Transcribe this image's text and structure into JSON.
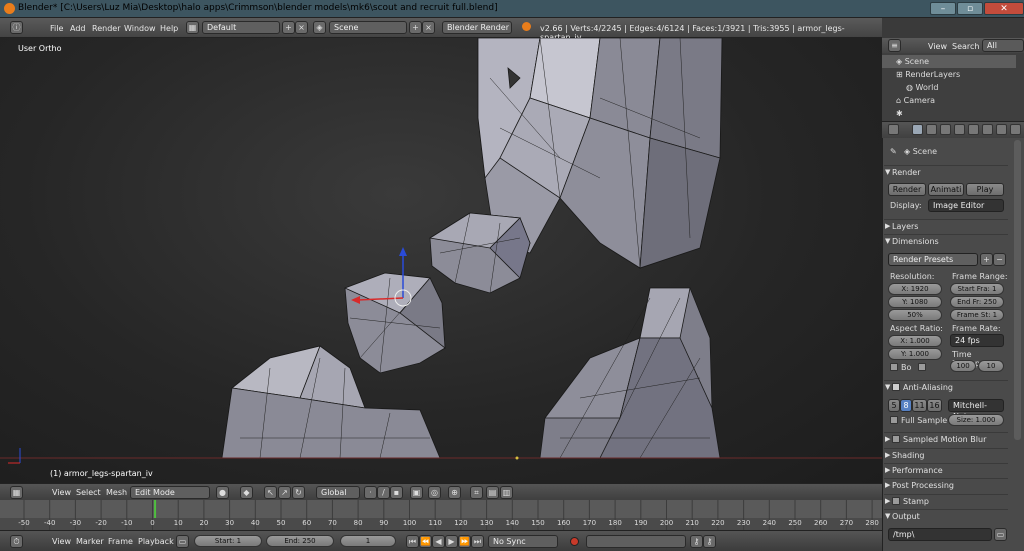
{
  "window": {
    "title": "Blender* [C:\\Users\\Luz Mia\\Desktop\\halo apps\\Crimmson\\blender models\\mk6\\scout and recruit full.blend]",
    "colors": {
      "accent": "#e97d1b",
      "titlebar": "#3d5560",
      "selected": "#5680c2"
    }
  },
  "menubar": {
    "items": [
      "File",
      "Add",
      "Render",
      "Window",
      "Help"
    ],
    "layout": "Default",
    "scene": "Scene",
    "engine": "Blender Render",
    "stats": "v2.66 | Verts:4/2245 | Edges:4/6124 | Faces:1/3921 | Tris:3955 | armor_legs-spartan_iv"
  },
  "viewport": {
    "view_label": "User Ortho",
    "object_label": "(1) armor_legs-spartan_iv"
  },
  "view_header": {
    "menus": [
      "View",
      "Select",
      "Mesh"
    ],
    "mode": "Edit Mode",
    "orientation": "Global"
  },
  "timeline": {
    "ticks": [
      "-50",
      "-40",
      "-30",
      "-20",
      "-10",
      "0",
      "10",
      "20",
      "30",
      "40",
      "50",
      "60",
      "70",
      "80",
      "90",
      "100",
      "110",
      "120",
      "130",
      "140",
      "150",
      "160",
      "170",
      "180",
      "190",
      "200",
      "210",
      "220",
      "230",
      "240",
      "250",
      "260",
      "270",
      "280"
    ],
    "current_frame": 1
  },
  "timeline_header": {
    "menus": [
      "View",
      "Marker",
      "Frame",
      "Playback"
    ],
    "start": "Start: 1",
    "end": "End: 250",
    "current": "1",
    "sync": "No Sync"
  },
  "outliner": {
    "header": [
      "View",
      "Search",
      "All Scenes"
    ],
    "rows": [
      "Scene",
      "RenderLayers",
      "World",
      "Camera"
    ]
  },
  "properties": {
    "context": "Scene",
    "render": {
      "title": "Render",
      "buttons": [
        "Render",
        "Animati",
        "Play"
      ],
      "display_label": "Display:",
      "display_value": "Image Editor"
    },
    "layers": "Layers",
    "dimensions": {
      "title": "Dimensions",
      "presets": "Render Presets",
      "resolution_label": "Resolution:",
      "res_x": "X: 1920",
      "res_y": "Y: 1080",
      "res_pct": "50%",
      "frame_range_label": "Frame Range:",
      "start": "Start Fra: 1",
      "end": "End Fr: 250",
      "step": "Frame St: 1",
      "aspect_label": "Aspect Ratio:",
      "asp_x": "X: 1.000",
      "asp_y": "Y: 1.000",
      "frame_rate_label": "Frame Rate:",
      "fps": "24 fps",
      "remap_label": "Time Remappin",
      "remap_old": "100",
      "remap_new": "10",
      "border": "Bo"
    },
    "anti_aliasing": {
      "title": "Anti-Aliasing",
      "samples": [
        "5",
        "8",
        "11",
        "16"
      ],
      "filter": "Mitchell-Netr",
      "full_sample": "Full Sample",
      "size": "Size: 1.000"
    },
    "sections": [
      "Sampled Motion Blur",
      "Shading",
      "Performance",
      "Post Processing",
      "Stamp",
      "Output"
    ],
    "output_path": "/tmp\\"
  }
}
